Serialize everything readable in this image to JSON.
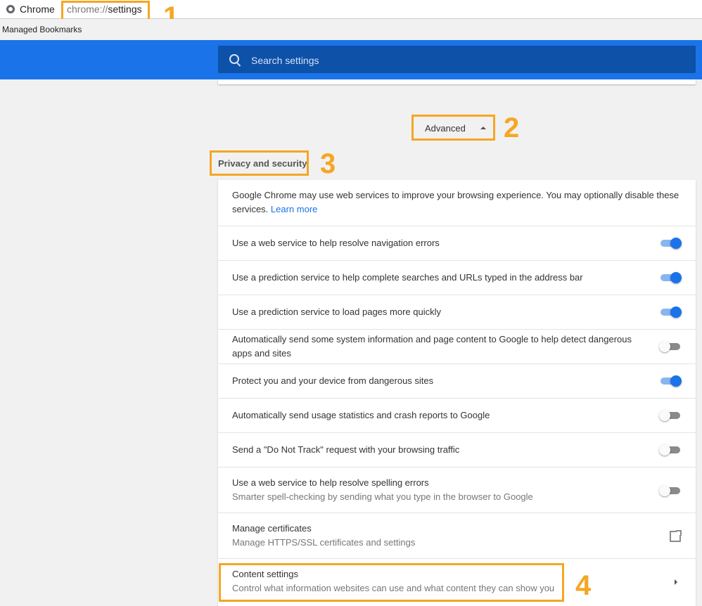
{
  "browser": {
    "app_name": "Chrome",
    "url_scheme": "chrome://",
    "url_path": "settings",
    "bookmark": "Managed Bookmarks"
  },
  "search": {
    "placeholder": "Search settings"
  },
  "advanced": {
    "label": "Advanced"
  },
  "section": {
    "title": "Privacy and security"
  },
  "intro": {
    "text": "Google Chrome may use web services to improve your browsing experience. You may optionally disable these services.",
    "link": "Learn more"
  },
  "rows": [
    {
      "label": "Use a web service to help resolve navigation errors",
      "control": "toggle",
      "on": true
    },
    {
      "label": "Use a prediction service to help complete searches and URLs typed in the address bar",
      "control": "toggle",
      "on": true
    },
    {
      "label": "Use a prediction service to load pages more quickly",
      "control": "toggle",
      "on": true
    },
    {
      "label": "Automatically send some system information and page content to Google to help detect dangerous apps and sites",
      "control": "toggle",
      "on": false
    },
    {
      "label": "Protect you and your device from dangerous sites",
      "control": "toggle",
      "on": true
    },
    {
      "label": "Automatically send usage statistics and crash reports to Google",
      "control": "toggle",
      "on": false
    },
    {
      "label": "Send a \"Do Not Track\" request with your browsing traffic",
      "control": "toggle",
      "on": false
    },
    {
      "label": "Use a web service to help resolve spelling errors",
      "sublabel": "Smarter spell-checking by sending what you type in the browser to Google",
      "control": "toggle",
      "on": false
    },
    {
      "label": "Manage certificates",
      "sublabel": "Manage HTTPS/SSL certificates and settings",
      "control": "external-link-icon"
    },
    {
      "label": "Content settings",
      "sublabel": "Control what information websites can use and what content they can show you",
      "control": "chevron-right-icon"
    }
  ],
  "callouts": [
    "1",
    "2",
    "3",
    "4"
  ],
  "colors": {
    "header_blue": "#1a73e8",
    "search_blue": "#0d51a8",
    "callout_orange": "#f5a623",
    "link_blue": "#1a73e8"
  }
}
